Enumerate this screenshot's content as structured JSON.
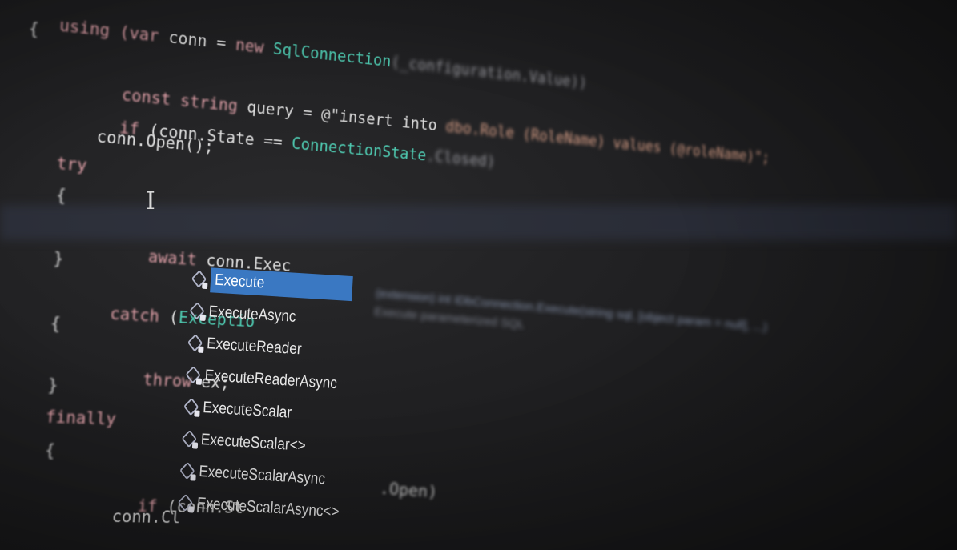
{
  "editor": {
    "lines": {
      "using_line": {
        "kw": "using (var",
        "rest": " conn = ",
        "new_kw": "new",
        "type": " SqlConnection",
        "tail": "(_configuration.Value))"
      },
      "open_brace_1": "{",
      "const_line": {
        "kw": "const string",
        "rest": " query = @\"insert into ",
        "str": "dbo.Role (RoleName) values (@roleName)\";"
      },
      "if_line": {
        "kw": "if",
        "rest": " (conn.State == ",
        "type": "ConnectionState",
        "tail": ".Closed)"
      },
      "open_call": "conn.Open();",
      "try_kw": "try",
      "open_brace_2": "{",
      "await_line": {
        "kw": "await",
        "rest": " conn.Exec"
      },
      "close_brace_2": "}",
      "catch_line": {
        "kw": "catch",
        "rest": " (",
        "type": "Exceptio"
      },
      "open_brace_3": "{",
      "throw_line": {
        "kw": "throw",
        "rest": " ex;"
      },
      "close_brace_3": "}",
      "finally_kw": "finally",
      "open_brace_4": "{",
      "if_line_2": {
        "kw": "if",
        "rest": " (conn.St"
      },
      "close_line": "conn.Cl",
      "open_frag": ".Open)"
    },
    "caret_glyph": "I"
  },
  "autocomplete": {
    "items": [
      {
        "label": "Execute",
        "selected": true
      },
      {
        "label": "ExecuteAsync",
        "selected": false
      },
      {
        "label": "ExecuteReader",
        "selected": false
      },
      {
        "label": "ExecuteReaderAsync",
        "selected": false
      },
      {
        "label": "ExecuteScalar",
        "selected": false
      },
      {
        "label": "ExecuteScalar<>",
        "selected": false
      },
      {
        "label": "ExecuteScalarAsync",
        "selected": false
      },
      {
        "label": "ExecuteScalarAsync<>",
        "selected": false
      }
    ],
    "icon": "extension-method-icon",
    "selection_color": "#3a78c2"
  },
  "tooltip": {
    "signature": "(extension) int IDbConnection.Execute(string sql, [object param = null], ...)",
    "description": "Execute parameterized SQL"
  }
}
